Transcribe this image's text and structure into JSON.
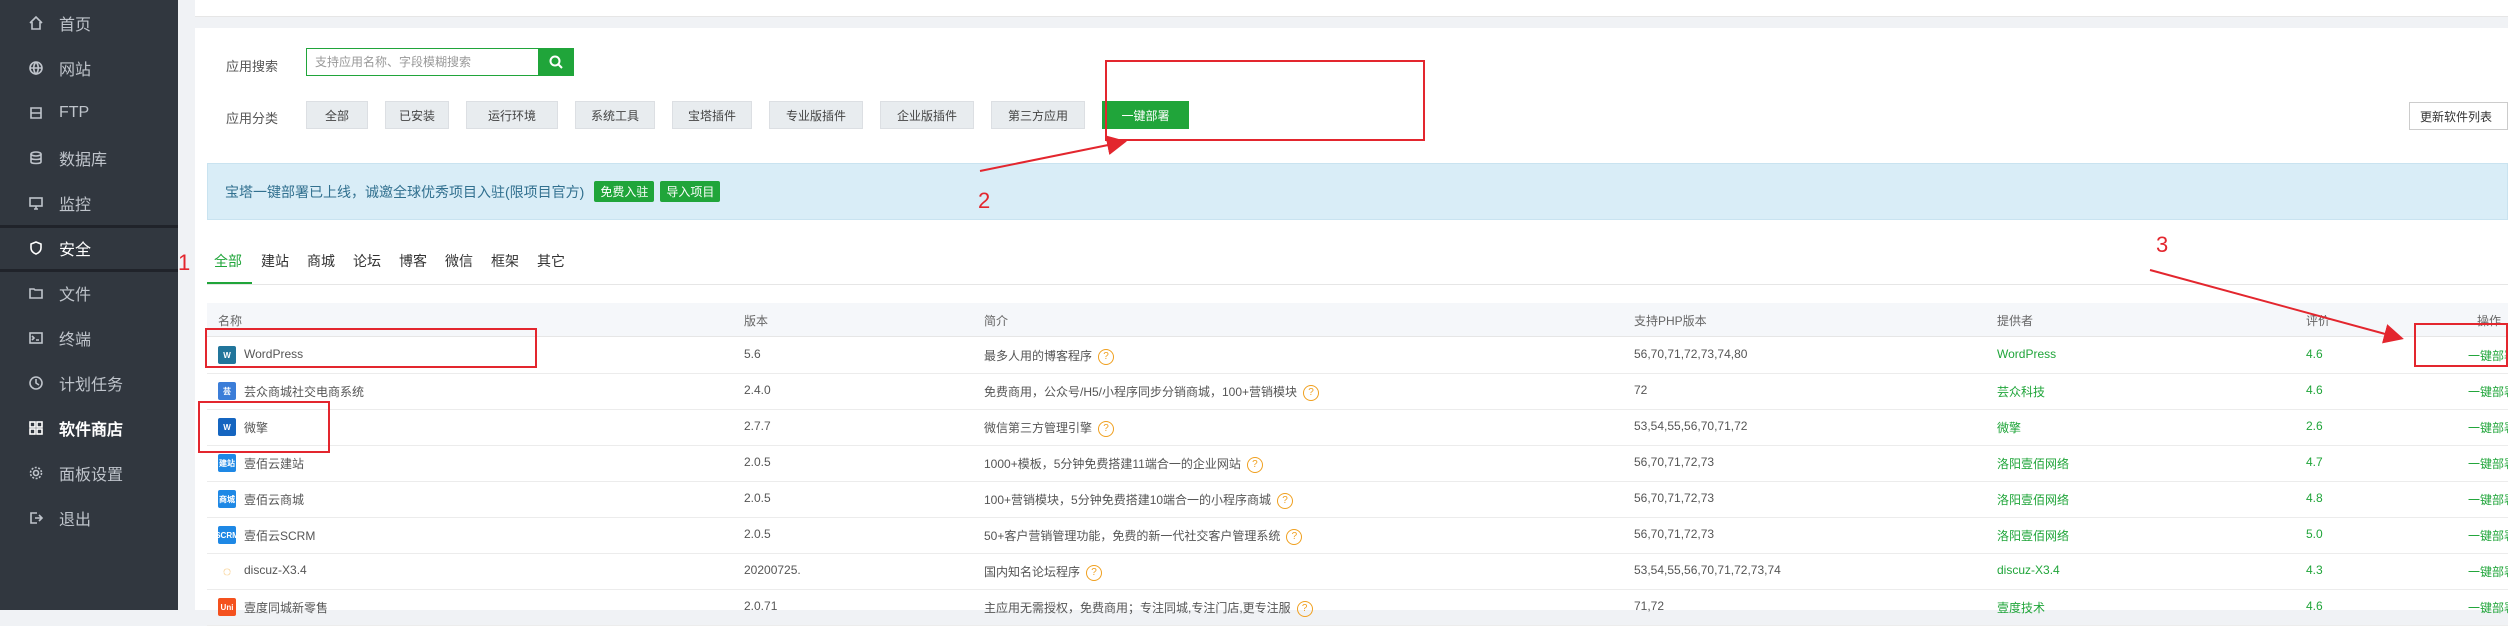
{
  "sidebar": {
    "items": [
      {
        "label": "首页",
        "icon": "home-icon"
      },
      {
        "label": "网站",
        "icon": "globe-icon"
      },
      {
        "label": "FTP",
        "icon": "ftp-icon"
      },
      {
        "label": "数据库",
        "icon": "database-icon"
      },
      {
        "label": "监控",
        "icon": "monitor-icon"
      },
      {
        "label": "安全",
        "icon": "shield-icon"
      },
      {
        "label": "文件",
        "icon": "folder-icon"
      },
      {
        "label": "终端",
        "icon": "terminal-icon"
      },
      {
        "label": "计划任务",
        "icon": "clock-icon"
      },
      {
        "label": "软件商店",
        "icon": "grid-icon"
      },
      {
        "label": "面板设置",
        "icon": "gear-icon"
      },
      {
        "label": "退出",
        "icon": "logout-icon"
      }
    ]
  },
  "search": {
    "label": "应用搜索",
    "placeholder": "支持应用名称、字段模糊搜索"
  },
  "category": {
    "label": "应用分类",
    "items": [
      "全部",
      "已安装",
      "运行环境",
      "系统工具",
      "宝塔插件",
      "专业版插件",
      "企业版插件",
      "第三方应用",
      "一键部署"
    ],
    "refresh_label": "更新软件列表"
  },
  "notice": {
    "text": "宝塔一键部署已上线，诚邀全球优秀项目入驻(限项目官方)",
    "btn_join": "免费入驻",
    "btn_import": "导入项目"
  },
  "tabs": [
    "全部",
    "建站",
    "商城",
    "论坛",
    "博客",
    "微信",
    "框架",
    "其它"
  ],
  "table": {
    "headers": {
      "name": "名称",
      "version": "版本",
      "desc": "简介",
      "php": "支持PHP版本",
      "provider": "提供者",
      "score": "评价",
      "action": "操作"
    },
    "rows": [
      {
        "name": "WordPress",
        "version": "5.6",
        "desc": "最多人用的博客程序",
        "php": "56,70,71,72,73,74,80",
        "provider": "WordPress",
        "score": "4.6",
        "action": "一键部署",
        "icon_color": "#21759b",
        "icon_text": "W"
      },
      {
        "name": "芸众商城社交电商系统",
        "version": "2.4.0",
        "desc": "免费商用，公众号/H5/小程序同步分销商城，100+营销模块",
        "php": "72",
        "provider": "芸众科技",
        "score": "4.6",
        "action": "一键部署",
        "icon_color": "#3b7dd8",
        "icon_text": "芸"
      },
      {
        "name": "微擎",
        "version": "2.7.7",
        "desc": "微信第三方管理引擎",
        "php": "53,54,55,56,70,71,72",
        "provider": "微擎",
        "score": "2.6",
        "action": "一键部署",
        "icon_color": "#1565c0",
        "icon_text": "W"
      },
      {
        "name": "壹佰云建站",
        "version": "2.0.5",
        "desc": "1000+模板，5分钟免费搭建11端合一的企业网站",
        "php": "56,70,71,72,73",
        "provider": "洛阳壹佰网络",
        "score": "4.7",
        "action": "一键部署",
        "icon_color": "#1e88e5",
        "icon_text": "建站"
      },
      {
        "name": "壹佰云商城",
        "version": "2.0.5",
        "desc": "100+营销模块，5分钟免费搭建10端合一的小程序商城",
        "php": "56,70,71,72,73",
        "provider": "洛阳壹佰网络",
        "score": "4.8",
        "action": "一键部署",
        "icon_color": "#1e88e5",
        "icon_text": "商城"
      },
      {
        "name": "壹佰云SCRM",
        "version": "2.0.5",
        "desc": "50+客户营销管理功能，免费的新一代社交客户管理系统",
        "php": "56,70,71,72,73",
        "provider": "洛阳壹佰网络",
        "score": "5.0",
        "action": "一键部署",
        "icon_color": "#1e88e5",
        "icon_text": "SCRM"
      },
      {
        "name": "discuz-X3.4",
        "version": "20200725.",
        "desc": "国内知名论坛程序",
        "php": "53,54,55,56,70,71,72,73,74",
        "provider": "discuz-X3.4",
        "score": "4.3",
        "action": "一键部署",
        "icon_color": "#ffffff",
        "icon_text": "◌"
      },
      {
        "name": "壹度同城新零售",
        "version": "2.0.71",
        "desc": "主应用无需授权，免费商用；专注同城,专注门店,更专注服",
        "php": "71,72",
        "provider": "壹度技术",
        "score": "4.6",
        "action": "一键部署",
        "icon_color": "#f4511e",
        "icon_text": "Uni"
      }
    ]
  },
  "annotations": [
    "1",
    "2",
    "3"
  ],
  "colors": {
    "accent": "#20a53a",
    "annotation": "#e3262e",
    "sidebar_bg": "#31373f"
  }
}
